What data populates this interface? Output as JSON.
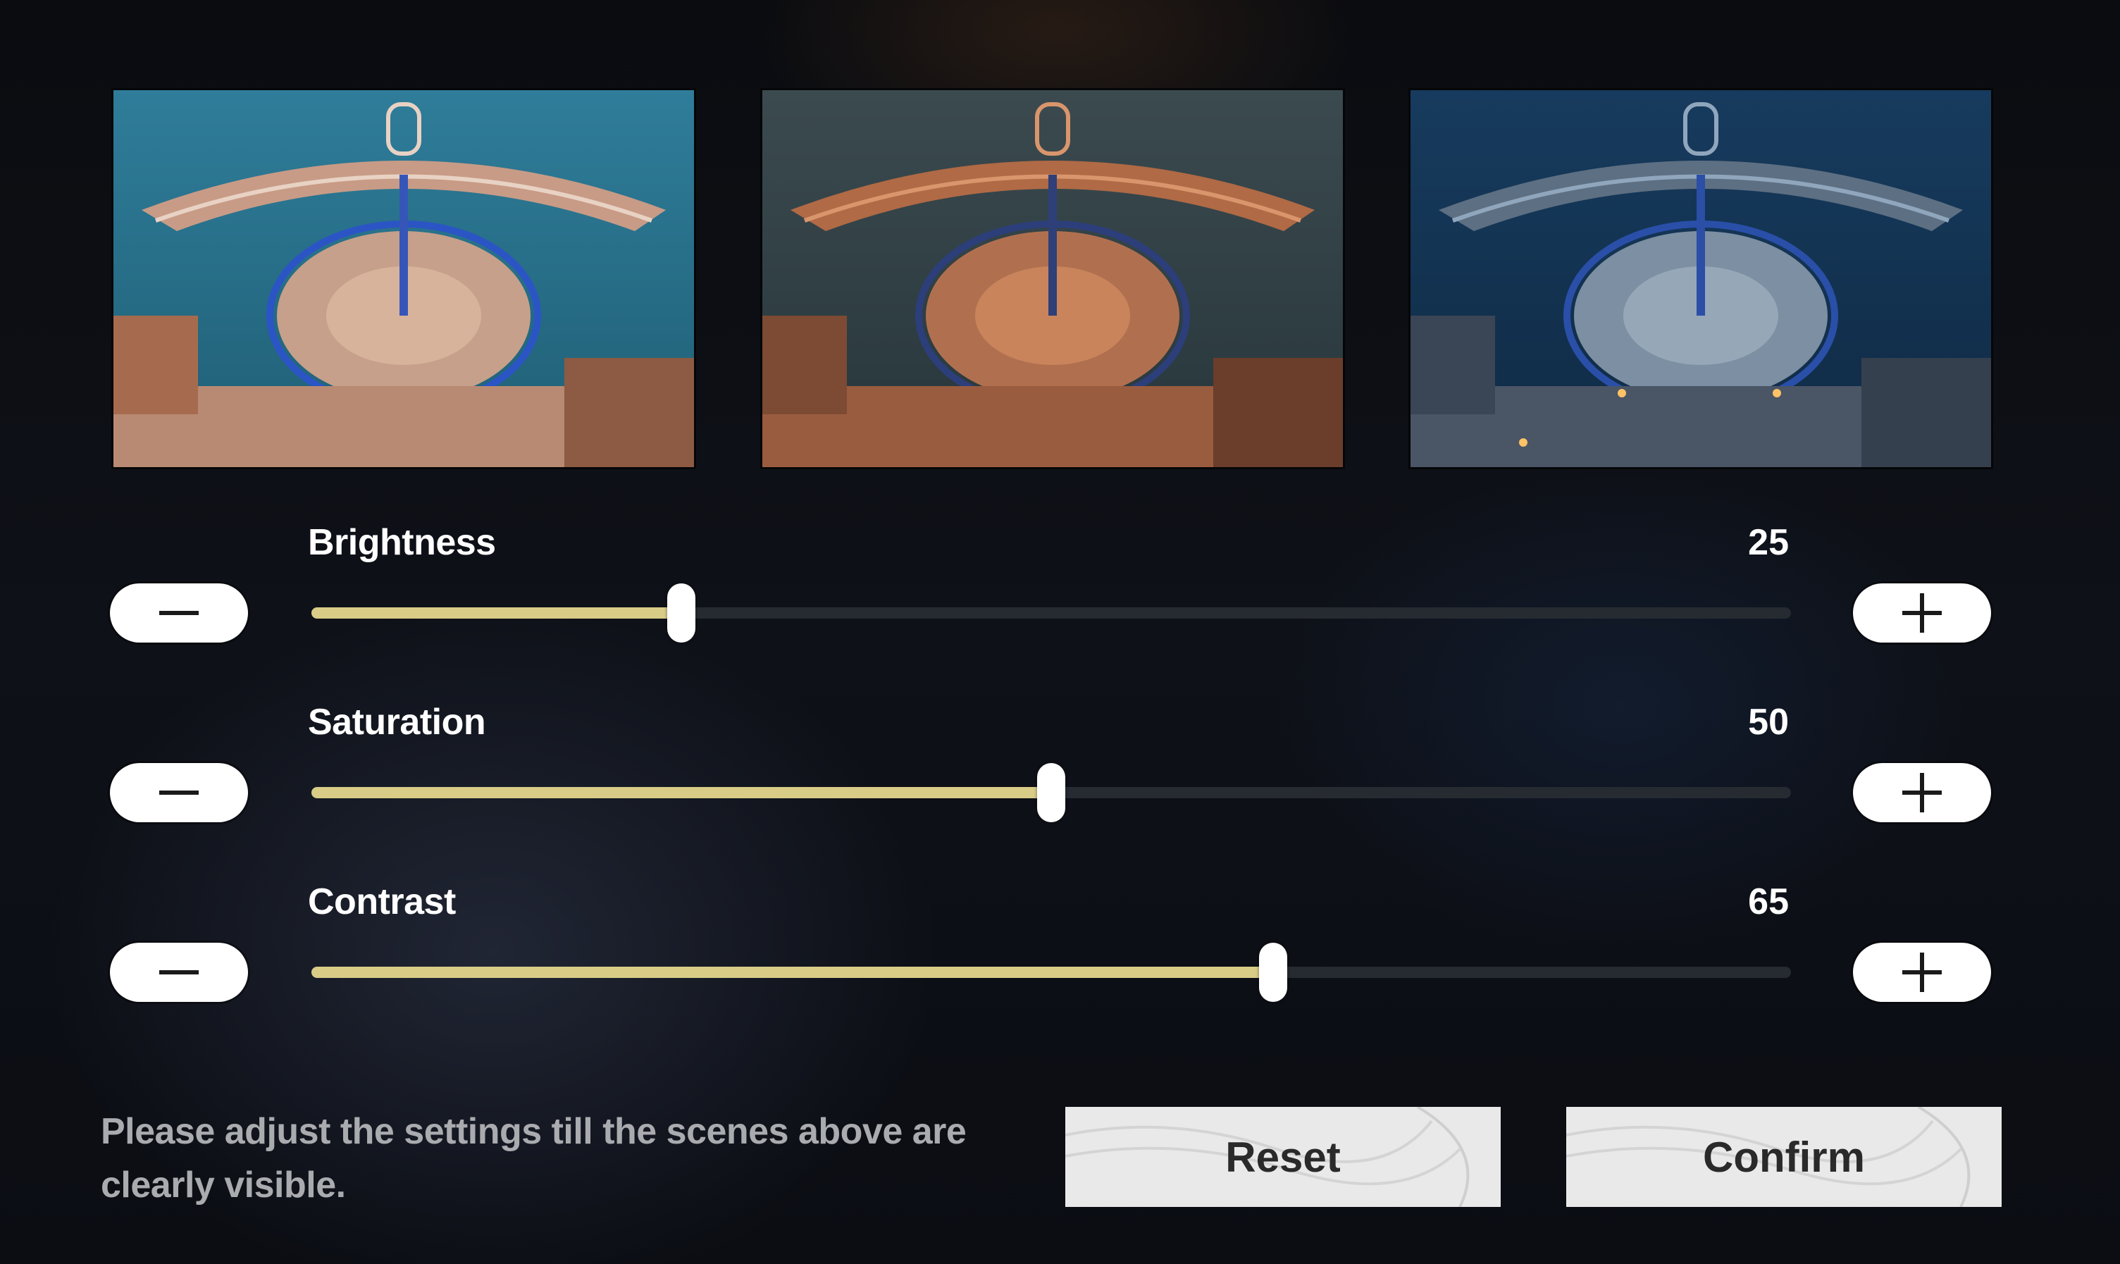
{
  "previews": [
    {
      "name": "scene-normal"
    },
    {
      "name": "scene-warm"
    },
    {
      "name": "scene-night"
    }
  ],
  "settings": {
    "brightness": {
      "label": "Brightness",
      "value": "25",
      "fraction": 0.25
    },
    "saturation": {
      "label": "Saturation",
      "value": "50",
      "fraction": 0.5
    },
    "contrast": {
      "label": "Contrast",
      "value": "65",
      "fraction": 0.65
    }
  },
  "hint": {
    "line1": "Please adjust the settings till the scenes above are",
    "line2": "clearly visible."
  },
  "buttons": {
    "reset": "Reset",
    "confirm": "Confirm"
  },
  "icons": {
    "decrease": "minus-icon",
    "increase": "plus-icon"
  },
  "colors": {
    "accent": "#d8cc87",
    "track": "#262a31",
    "button": "#e9e9e9"
  }
}
